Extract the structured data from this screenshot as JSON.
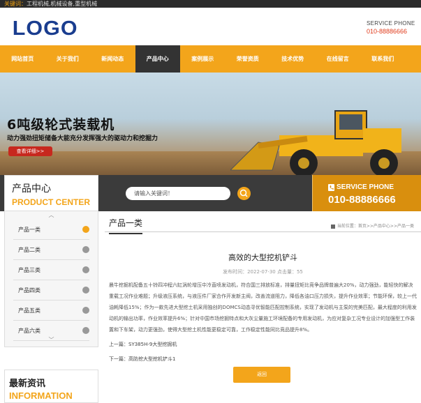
{
  "topbar": {
    "label": "关键词：",
    "keywords": "工程机械,机械设备,重型机械"
  },
  "header": {
    "logo": "LOGO",
    "service_label": "SERVICE PHONE",
    "service_number": "010-88886666"
  },
  "nav": {
    "items": [
      "网站首页",
      "关于我们",
      "新闻动态",
      "产品中心",
      "案例展示",
      "荣誉资质",
      "技术优势",
      "在线留言",
      "联系我们"
    ],
    "active_index": 3
  },
  "banner": {
    "title": "6吨级轮式装载机",
    "subtitle": "动力强劲扭矩储备大能充分发挥强大的驱动力和挖掘力",
    "button": "查看详细>>"
  },
  "search": {
    "placeholder": "请输入关键词！"
  },
  "service": {
    "label": "SERVICE PHONE",
    "number": "010-88886666"
  },
  "sidebar": {
    "title_cn": "产品中心",
    "title_en": "PRODUCT CENTER",
    "items": [
      "产品一类",
      "产品二类",
      "产品三类",
      "产品四类",
      "产品五类",
      "产品六类"
    ],
    "active_index": 0
  },
  "news": {
    "title_cn": "最新资讯",
    "title_en": "INFORMATION"
  },
  "main": {
    "section_title": "产品一类",
    "breadcrumb": "当前位置：首页>>产品中心>>产品一类",
    "article_title": "高效的大型挖机铲斗",
    "meta": "发布时间：2022-07-30    点击量：55",
    "body": "晨牛挖掘机配备五十铃四冲程六缸涡轮增压中冷直喷发动机，符合国三排放标准，排量扭矩比竞争品牌普遍大20%，动力强劲，能轻快的解决重载工况作业难题；升级液压系统，与液压件厂家合作开发新主阀，改善流道阻力，降低各油口压力损失，提升作业效率；节能环保，较上一代油耗降低15%；作为一款先进大型挖土机采用独创的DOMCS动态寻优智能匹配控制系统，实现了发动机与主泵的完美匹配，最大程度的利用发动机的输出功率，作业效率提升6%；针对中国市场挖掘特点和大灰尘量施工环境配备的专用发动机，为应对复杂工况专业设计的加强型工作装置和下车架，动力更强劲，使得大型挖土机性能更稳定可靠，工作稳定性能同比竞品提升8%。",
    "prev": "上一篇：SY385H-9大型挖掘机",
    "next": "下一篇：高防挖大型挖机铲斗1",
    "back_button": "返回"
  }
}
